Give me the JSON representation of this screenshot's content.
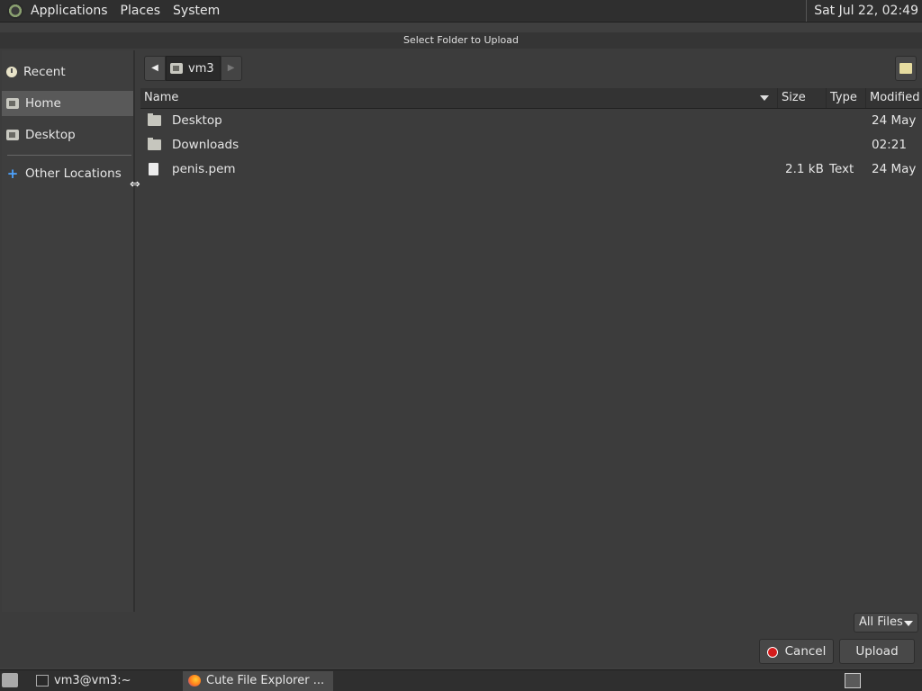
{
  "top_panel": {
    "menus": [
      "Applications",
      "Places",
      "System"
    ],
    "clock": "Sat Jul 22, 02:49"
  },
  "dialog": {
    "title": "Select Folder to Upload",
    "sidebar": {
      "items": [
        {
          "label": "Recent",
          "icon": "clock-icon"
        },
        {
          "label": "Home",
          "icon": "home-folder-icon",
          "selected": true
        },
        {
          "label": "Desktop",
          "icon": "desktop-folder-icon"
        },
        {
          "label": "Other Locations",
          "icon": "plus-icon"
        }
      ]
    },
    "pathbar": {
      "crumb": "vm3"
    },
    "columns": {
      "name": "Name",
      "size": "Size",
      "type": "Type",
      "modified": "Modified"
    },
    "files": [
      {
        "name": "Desktop",
        "size": "",
        "type": "",
        "modified": "24 May",
        "kind": "folder"
      },
      {
        "name": "Downloads",
        "size": "",
        "type": "",
        "modified": "02:21",
        "kind": "folder"
      },
      {
        "name": "penis.pem",
        "size": "2.1 kB",
        "type": "Text",
        "modified": "24 May",
        "kind": "file"
      }
    ],
    "filter": "All Files",
    "buttons": {
      "cancel": "Cancel",
      "upload": "Upload"
    }
  },
  "taskbar": {
    "tasks": [
      {
        "label": "vm3@vm3:~",
        "icon": "terminal-icon"
      },
      {
        "label": "Cute File Explorer ...",
        "icon": "firefox-icon",
        "active": true
      }
    ]
  }
}
